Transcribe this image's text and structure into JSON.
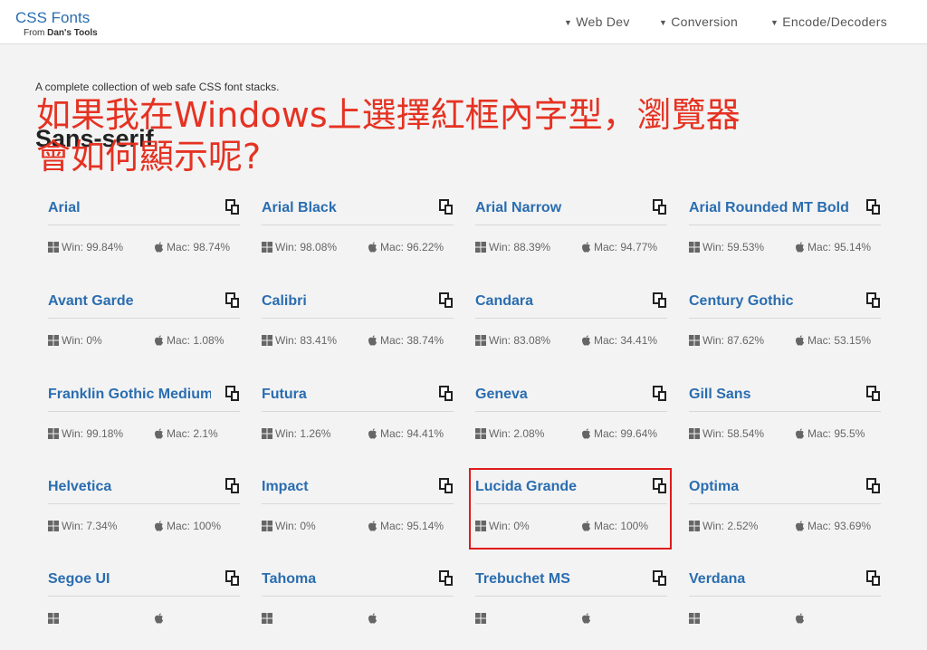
{
  "header": {
    "brand_title": "CSS Fonts",
    "brand_from": "From",
    "brand_tools": "Dan's Tools",
    "nav": [
      "Web Dev",
      "Conversion",
      "Encode/Decoders"
    ]
  },
  "page": {
    "tagline": "A complete collection of web safe CSS font stacks.",
    "section_title": "Sans-serif"
  },
  "overlay": {
    "line1": "如果我在Windows上選擇紅框內字型，瀏覽器",
    "line2": "會如何顯示呢?",
    "color": "#e53222"
  },
  "colors": {
    "link": "#2a6db0",
    "highlight": "#e01b1b"
  },
  "fonts": [
    {
      "name": "Arial",
      "win": "Win: 99.84%",
      "mac": "Mac: 98.74%"
    },
    {
      "name": "Arial Black",
      "win": "Win: 98.08%",
      "mac": "Mac: 96.22%"
    },
    {
      "name": "Arial Narrow",
      "win": "Win: 88.39%",
      "mac": "Mac: 94.77%"
    },
    {
      "name": "Arial Rounded MT Bold",
      "win": "Win: 59.53%",
      "mac": "Mac: 95.14%"
    },
    {
      "name": "Avant Garde",
      "win": "Win: 0%",
      "mac": "Mac: 1.08%"
    },
    {
      "name": "Calibri",
      "win": "Win: 83.41%",
      "mac": "Mac: 38.74%"
    },
    {
      "name": "Candara",
      "win": "Win: 83.08%",
      "mac": "Mac: 34.41%"
    },
    {
      "name": "Century Gothic",
      "win": "Win: 87.62%",
      "mac": "Mac: 53.15%"
    },
    {
      "name": "Franklin Gothic Medium",
      "win": "Win: 99.18%",
      "mac": "Mac: 2.1%"
    },
    {
      "name": "Futura",
      "win": "Win: 1.26%",
      "mac": "Mac: 94.41%"
    },
    {
      "name": "Geneva",
      "win": "Win: 2.08%",
      "mac": "Mac: 99.64%"
    },
    {
      "name": "Gill Sans",
      "win": "Win: 58.54%",
      "mac": "Mac: 95.5%"
    },
    {
      "name": "Helvetica",
      "win": "Win: 7.34%",
      "mac": "Mac: 100%"
    },
    {
      "name": "Impact",
      "win": "Win: 0%",
      "mac": "Mac: 95.14%"
    },
    {
      "name": "Lucida Grande",
      "win": "Win: 0%",
      "mac": "Mac: 100%"
    },
    {
      "name": "Optima",
      "win": "Win: 2.52%",
      "mac": "Mac: 93.69%"
    },
    {
      "name": "Segoe UI",
      "win": "",
      "mac": ""
    },
    {
      "name": "Tahoma",
      "win": "",
      "mac": ""
    },
    {
      "name": "Trebuchet MS",
      "win": "",
      "mac": ""
    },
    {
      "name": "Verdana",
      "win": "",
      "mac": ""
    }
  ]
}
